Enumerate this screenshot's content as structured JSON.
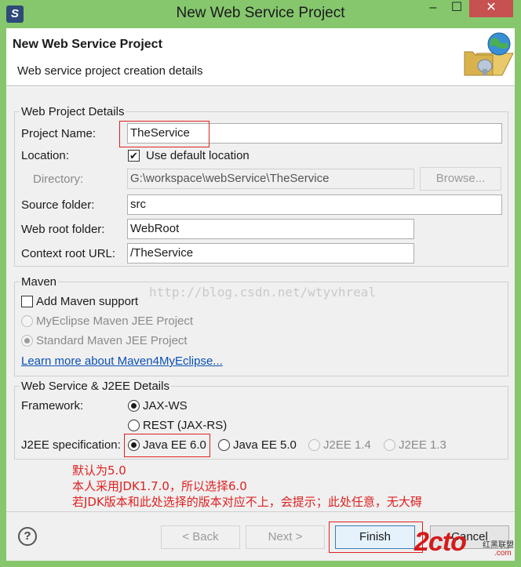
{
  "window": {
    "title": "New Web Service Project",
    "app_icon_glyph": "S",
    "minimize": "–",
    "maximize": "☐",
    "close": "✕"
  },
  "header": {
    "title": "New Web Service Project",
    "description": "Web service project creation details"
  },
  "web_project": {
    "legend": "Web Project Details",
    "project_name_label": "Project Name:",
    "project_name_value": "TheService",
    "location_label": "Location:",
    "use_default_label": "Use default location",
    "use_default_checked": true,
    "directory_label": "Directory:",
    "directory_value": "G:\\workspace\\webService\\TheService",
    "browse_label": "Browse...",
    "source_folder_label": "Source folder:",
    "source_folder_value": "src",
    "web_root_label": "Web root folder:",
    "web_root_value": "WebRoot",
    "context_root_label": "Context root URL:",
    "context_root_value": "/TheService"
  },
  "maven": {
    "legend": "Maven",
    "add_support_label": "Add Maven support",
    "add_support_checked": false,
    "myeclipse_jee_label": "MyEclipse Maven JEE Project",
    "standard_jee_label": "Standard Maven JEE Project",
    "learn_more_link": "Learn more about Maven4MyEclipse..."
  },
  "ws_j2ee": {
    "legend": "Web Service & J2EE Details",
    "framework_label": "Framework:",
    "framework_options": [
      "JAX-WS",
      "REST (JAX-RS)"
    ],
    "framework_selected": "JAX-WS",
    "j2ee_label": "J2EE specification:",
    "j2ee_options": [
      "Java EE 6.0",
      "Java EE 5.0",
      "J2EE 1.4",
      "J2EE 1.3"
    ],
    "j2ee_selected": "Java EE 6.0"
  },
  "annotations": {
    "line1": "默认为5.0",
    "line2": "本人采用JDK1.7.0，所以选择6.0",
    "line3": "若JDK版本和此处选择的版本对应不上，会提示；此处任意，无大碍"
  },
  "watermark": "http://blog.csdn.net/wtyvhreal",
  "footer": {
    "help_glyph": "?",
    "back_label": "< Back",
    "next_label": "Next >",
    "finish_label": "Finish",
    "cancel_label": "Cancel"
  },
  "logo": {
    "brand": "2cto",
    "tagline": "红黑联盟",
    "url": ".com"
  },
  "colors": {
    "titlebar": "#86c76e",
    "annotation_red": "#e02020",
    "link_blue": "#0a50b4"
  }
}
